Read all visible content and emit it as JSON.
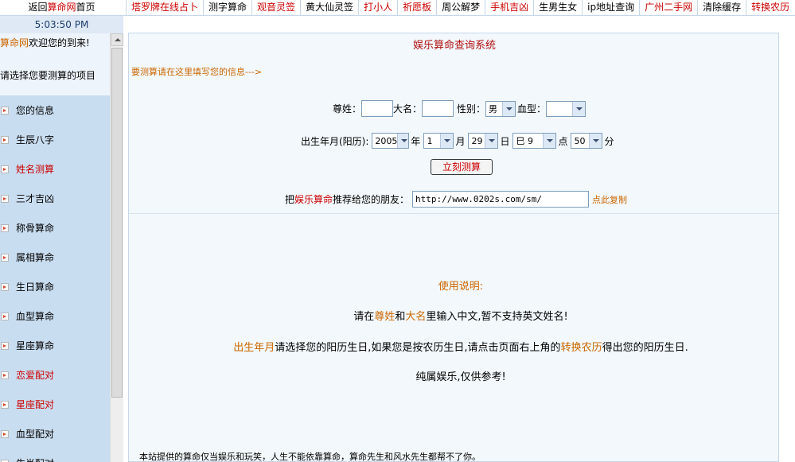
{
  "topbar": {
    "home_prefix": "返回",
    "home_brand": "算命网",
    "home_suffix": "首页",
    "nav": [
      {
        "label": "塔罗牌在线占卜",
        "red": true
      },
      {
        "label": "测字算命",
        "red": false
      },
      {
        "label": "观音灵签",
        "red": true
      },
      {
        "label": "黄大仙灵签",
        "red": false
      },
      {
        "label": "打小人",
        "red": true
      },
      {
        "label": "祈愿板",
        "red": true
      },
      {
        "label": "周公解梦",
        "red": false
      },
      {
        "label": "手机吉凶",
        "red": true
      },
      {
        "label": "生男生女",
        "red": false
      },
      {
        "label": "ip地址查询",
        "red": false
      },
      {
        "label": "广州二手网",
        "red": true
      },
      {
        "label": "清除缓存",
        "red": false
      },
      {
        "label": "转换农历",
        "red": true
      }
    ]
  },
  "sidebar": {
    "clock": "5:03:50 PM",
    "welcome_brand": "算命网",
    "welcome_text": "欢迎您的到来!",
    "choose_text": "请选择您要测算的项目",
    "items": [
      {
        "label": "您的信息",
        "red": false
      },
      {
        "label": "生辰八字",
        "red": false
      },
      {
        "label": "姓名测算",
        "red": true
      },
      {
        "label": "三才吉凶",
        "red": false
      },
      {
        "label": "称骨算命",
        "red": false
      },
      {
        "label": "属相算命",
        "red": false
      },
      {
        "label": "生日算命",
        "red": false
      },
      {
        "label": "血型算命",
        "red": false
      },
      {
        "label": "星座算命",
        "red": false
      },
      {
        "label": "恋爱配对",
        "red": true
      },
      {
        "label": "星座配对",
        "red": true
      },
      {
        "label": "血型配对",
        "red": false
      },
      {
        "label": "生肖配对",
        "red": false
      }
    ]
  },
  "main": {
    "title": "娱乐算命查询系统",
    "prompt": "要测算请在这里填写您的信息--->",
    "form": {
      "surname_label": "尊姓：",
      "name_label": "大名：",
      "gender_label": "性别：",
      "gender_value": "男",
      "blood_label": "血型：",
      "blood_value": "",
      "birth_label": "出生年月(阳历):",
      "year_value": "2005",
      "year_unit": "年",
      "month_value": "1",
      "month_unit": "月",
      "day_value": "29",
      "day_unit": "日",
      "hour_value": "巳 9",
      "hour_unit": "点",
      "minute_value": "50",
      "minute_unit": "分",
      "submit_label": "立刻测算"
    },
    "share": {
      "prefix": "把",
      "brand": "娱乐算命",
      "suffix": "推荐给您的朋友：",
      "url": "http://www.0202s.com/sm/",
      "copy_label": "点此复制"
    },
    "usage": {
      "title": "使用说明:",
      "line1_a": "请在",
      "line1_b": "尊姓",
      "line1_c": "和",
      "line1_d": "大名",
      "line1_e": "里输入中文,暂不支持英文姓名!",
      "line2_a": "出生年月",
      "line2_b": "请选择您的阳历生日,如果您是按农历生日,请点击页面右上角的",
      "line2_c": "转换农历",
      "line2_d": "得出您的阳历生日.",
      "line3": "纯属娱乐,仅供参考!"
    },
    "footer_note": "本站提供的算命仅当娱乐和玩笑，人生不能依靠算命，算命先生和风水先生都帮不了你。"
  }
}
